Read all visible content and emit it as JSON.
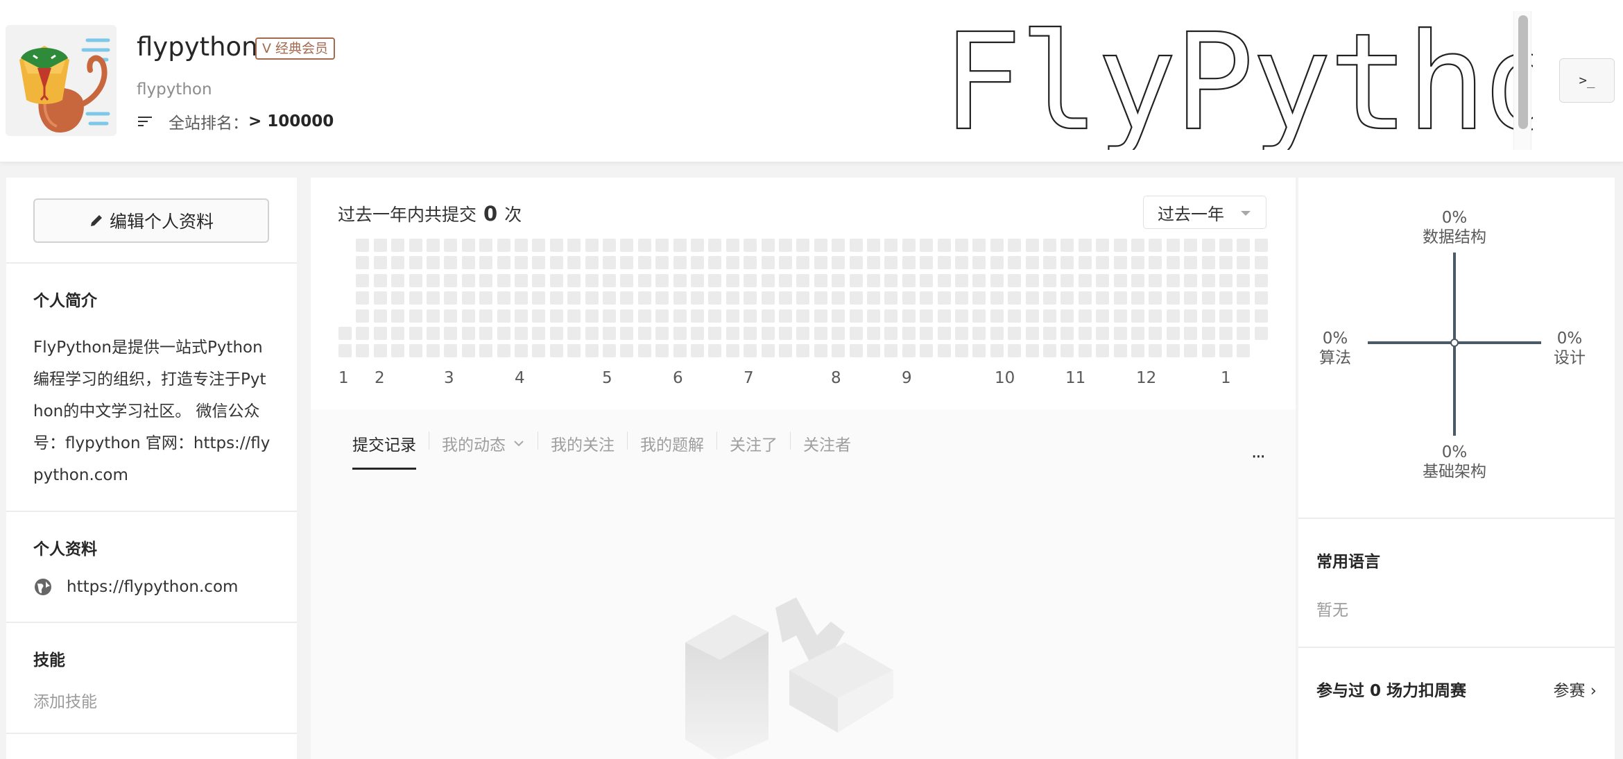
{
  "profile": {
    "username": "flypython",
    "handle": "flypython",
    "vip_badge": "V 经典会员",
    "rank_label": "全站排名：",
    "rank_value": "> 100000",
    "banner_text": "FlyPython",
    "terminal_button": ">_"
  },
  "sidebar": {
    "edit_button": "编辑个人资料",
    "bio_title": "个人简介",
    "bio_text": "FlyPython是提供一站式Python编程学习的组织，打造专注于Python的中文学习社区。 微信公众号：flypython 官网：https://flypython.com",
    "info_title": "个人资料",
    "website": "https://flypython.com",
    "skills_title": "技能",
    "skills_placeholder": "添加技能"
  },
  "activity": {
    "summary_prefix": "过去一年内共提交",
    "summary_count": "0",
    "summary_suffix": "次",
    "range_select": "过去一年",
    "months": [
      "1",
      "2",
      "3",
      "4",
      "5",
      "6",
      "7",
      "8",
      "9",
      "10",
      "11",
      "12",
      "1"
    ]
  },
  "tabs": [
    {
      "label": "提交记录",
      "active": true
    },
    {
      "label": "我的动态",
      "active": false,
      "dropdown": true
    },
    {
      "label": "我的关注",
      "active": false
    },
    {
      "label": "我的题解",
      "active": false
    },
    {
      "label": "关注了",
      "active": false
    },
    {
      "label": "关注者",
      "active": false
    }
  ],
  "more_label": "···",
  "radar": {
    "top": {
      "pct": "0%",
      "name": "数据结构"
    },
    "left": {
      "pct": "0%",
      "name": "算法"
    },
    "right": {
      "pct": "0%",
      "name": "设计"
    },
    "bottom": {
      "pct": "0%",
      "name": "基础架构"
    }
  },
  "languages": {
    "title": "常用语言",
    "empty": "暂无"
  },
  "contest": {
    "prefix": "参与过",
    "count": "0",
    "suffix": "场力扣周赛",
    "link": "参赛 ›"
  },
  "colors": {
    "vip": "#a36a4f",
    "heat_empty": "#ebebeb",
    "radar_axis": "#4a5a66",
    "snake_green": "#2e8b3a",
    "snake_orange": "#c8663d",
    "snake_yellow": "#f2b53c"
  }
}
